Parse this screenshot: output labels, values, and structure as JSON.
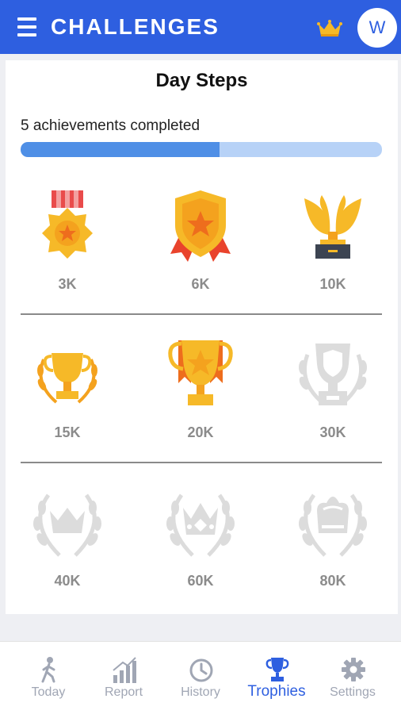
{
  "header": {
    "title": "CHALLENGES",
    "menu_icon": "hamburger-menu-icon",
    "premium_icon": "crown-icon",
    "avatar_initial": "W",
    "color": "#2e5fe0"
  },
  "card": {
    "title": "Day Steps",
    "progress_text": "5 achievements completed",
    "progress_fraction": 0.55,
    "badges": [
      {
        "label": "3K",
        "icon": "medal-star-icon",
        "achieved": true
      },
      {
        "label": "6K",
        "icon": "shield-ribbon-icon",
        "achieved": true
      },
      {
        "label": "10K",
        "icon": "winged-trophy-icon",
        "achieved": true
      },
      {
        "label": "15K",
        "icon": "laurel-trophy-icon",
        "achieved": true
      },
      {
        "label": "20K",
        "icon": "star-cup-icon",
        "achieved": true
      },
      {
        "label": "30K",
        "icon": "shield-cup-icon",
        "achieved": false
      },
      {
        "label": "40K",
        "icon": "laurel-crown-icon",
        "achieved": false
      },
      {
        "label": "60K",
        "icon": "laurel-jeweled-crown-icon",
        "achieved": false
      },
      {
        "label": "80K",
        "icon": "laurel-royal-crown-icon",
        "achieved": false
      }
    ]
  },
  "nav": {
    "items": [
      {
        "label": "Today",
        "icon": "walking-person-icon"
      },
      {
        "label": "Report",
        "icon": "bar-chart-icon"
      },
      {
        "label": "History",
        "icon": "clock-icon"
      },
      {
        "label": "Trophies",
        "icon": "trophy-icon",
        "active": true
      },
      {
        "label": "Settings",
        "icon": "gear-icon"
      }
    ]
  }
}
